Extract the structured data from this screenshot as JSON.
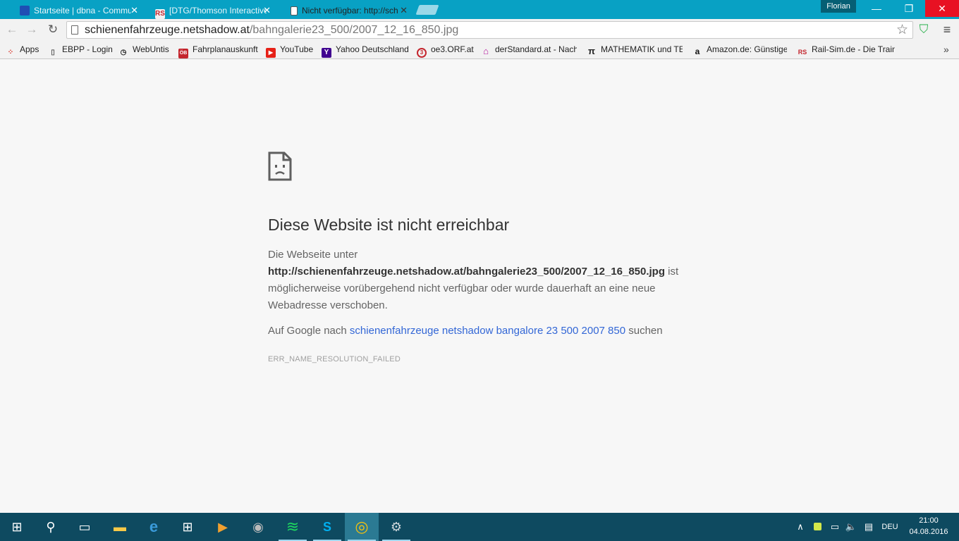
{
  "browser": {
    "tabs": [
      {
        "title": "Startseite | dbna - Commu",
        "favicon_color": "#1f4fb4",
        "active": false
      },
      {
        "title": "[DTG/Thomson Interactive",
        "favicon_label": "RS",
        "favicon_color": "#c4262e",
        "active": false
      },
      {
        "title": "Nicht verfügbar: http://sch",
        "active": true
      }
    ],
    "profile_name": "Florian",
    "window_controls": {
      "minimize": "—",
      "restore": "❐",
      "close": "✕"
    },
    "nav": {
      "back": "←",
      "forward": "→",
      "reload": "↻"
    },
    "url_host": "schienenfahrzeuge.netshadow.at",
    "url_path": "/bahngalerie23_500/2007_12_16_850.jpg",
    "star": "☆",
    "shield": "⛉",
    "menu": "≡"
  },
  "bookmarks": [
    {
      "label": "Apps",
      "icon": "apps-icon",
      "color": "#d93025"
    },
    {
      "label": "EBPP - Login",
      "icon": "page-icon",
      "color": "#555555"
    },
    {
      "label": "WebUntis",
      "icon": "clock-icon",
      "color": "#222222"
    },
    {
      "label": "Fahrplanauskunft",
      "icon": "obb-icon",
      "color": "#c4262e"
    },
    {
      "label": "YouTube",
      "icon": "youtube-icon",
      "color": "#e62117"
    },
    {
      "label": "Yahoo Deutschland",
      "icon": "yahoo-icon",
      "color": "#400090"
    },
    {
      "label": "oe3.ORF.at",
      "icon": "oe3-icon",
      "color": "#c4262e"
    },
    {
      "label": "derStandard.at - Nach",
      "icon": "house-icon",
      "color": "#b5179e"
    },
    {
      "label": "MATHEMATIK und TEC",
      "icon": "pi-icon",
      "color": "#222222"
    },
    {
      "label": "Amazon.de: Günstige",
      "icon": "amazon-icon",
      "color": "#111111"
    },
    {
      "label": "Rail-Sim.de - Die Train",
      "icon": "rs-icon",
      "color": "#c4262e"
    }
  ],
  "bookmark_glyphs": {
    "apps": "⁘",
    "page": "▯",
    "clock": "◷",
    "obb": "ÖB",
    "youtube": "▶",
    "yahoo": "Y",
    "oe3": "3",
    "house": "⌂",
    "pi": "π",
    "amazon": "a",
    "rs": "RS"
  },
  "bookmarks_overflow": "»",
  "error_page": {
    "title": "Diese Website ist nicht erreichbar",
    "body_prefix": "Die Webseite unter",
    "body_url": "http://schienenfahrzeuge.netshadow.at/bahngalerie23_500/2007_12_16_850.jpg",
    "body_suffix_1": " ist",
    "body_suffix_2": "möglicherweise vorübergehend nicht verfügbar oder wurde dauerhaft an eine neue Webadresse verschoben.",
    "suggest_prefix": "Auf Google nach ",
    "suggest_link": "schienenfahrzeuge netshadow bangalore 23 500 2007 850",
    "suggest_suffix": " suchen",
    "error_code": "ERR_NAME_RESOLUTION_FAILED"
  },
  "taskbar": {
    "start": "⊞",
    "search": "⚲",
    "taskview": "▭",
    "apps": [
      {
        "name": "file-explorer",
        "glyph": "▬",
        "color": "#f7c948"
      },
      {
        "name": "edge",
        "glyph": "e",
        "color": "#3a9ad9"
      },
      {
        "name": "store",
        "glyph": "⊞",
        "color": "#ffffff"
      },
      {
        "name": "media-player",
        "glyph": "▶",
        "color": "#f0a030"
      },
      {
        "name": "speaker-app",
        "glyph": "◉",
        "color": "#bbbbbb"
      },
      {
        "name": "spotify",
        "glyph": "≋",
        "color": "#1ed760"
      },
      {
        "name": "skype",
        "glyph": "S",
        "color": "#00aff0"
      },
      {
        "name": "chrome",
        "glyph": "◎",
        "color": "#f4c20d"
      },
      {
        "name": "steam",
        "glyph": "⚙",
        "color": "#cfd8dc"
      }
    ],
    "tray": {
      "chevron": "∧",
      "language": "DEU",
      "volume": "🔈",
      "network": "▭",
      "notifications": "▤"
    },
    "clock_time": "21:00",
    "clock_date": "04.08.2016"
  }
}
